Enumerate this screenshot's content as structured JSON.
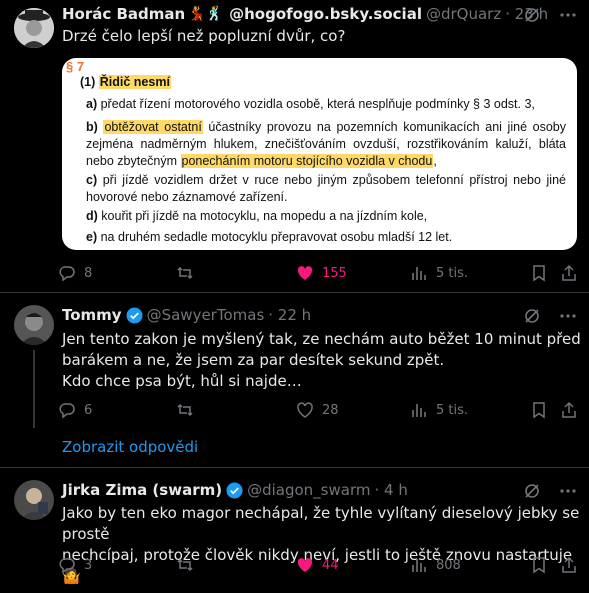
{
  "tweets": [
    {
      "name": "Horác Badman",
      "name_emoji": "💃🕺",
      "bsky": "@hogofogo.bsky.social",
      "handle": "@drQuarz",
      "time": "· 23 h",
      "text": "Drzé čelo lepší než popluzní dvůr, co?",
      "stats": {
        "replies": "8",
        "retweets": "",
        "likes": "155",
        "views": "5 tis."
      }
    },
    {
      "name": "Tommy",
      "handle": "@SawyerTomas",
      "time": "· 22 h",
      "text": "Jen tento zakon je myšlený tak, ze nechám auto běžet 10 minut před\nbarákem a ne, že jsem za par desítek sekund zpět.\nKdo chce psa být, hůl si najde…",
      "stats": {
        "replies": "6",
        "retweets": "",
        "likes": "28",
        "views": "5 tis."
      }
    },
    {
      "name": "Jirka Zima (swarm)",
      "handle": "@diagon_swarm",
      "time": "· 4 h",
      "text": "Jako by ten eko magor nechápal, že tyhle vylítaný dieselový jebky se prostě\nnechcípaj, protože člověk nikdy neví, jestli to ještě znovu nastartuje 🤷",
      "stats": {
        "replies": "3",
        "retweets": "",
        "likes": "44",
        "views": "808"
      }
    }
  ],
  "show_replies": "Zobrazit odpovědi",
  "law": {
    "section": "§ 7",
    "lead_num": "(1)",
    "lead_text": "Řidič nesmí",
    "a_letter": "a)",
    "a_text": "předat řízení motorového vozidla osobě, která nesplňuje podmínky § 3 odst. 3,",
    "b_letter": "b)",
    "b_hl1": "obtěžovat ostatní",
    "b_text1": " účastníky provozu na pozemních komunikacích ani jiné osoby zejména nadměrným hlukem, znečišťováním ovzduší, rozstřikováním kaluží, bláta nebo zbytečným ",
    "b_hl2": "ponecháním motoru stojícího vozidla v chodu",
    "b_text2": ",",
    "c_letter": "c)",
    "c_text": "při jízdě vozidlem držet v ruce nebo jiným způsobem telefonní přístroj nebo jiné hovorové nebo záznamové zařízení.",
    "d_letter": "d)",
    "d_text": "kouřit při jízdě na motocyklu, na mopedu a na jízdním kole,",
    "e_letter": "e)",
    "e_text": "na druhém sedadle motocyklu přepravovat osobu mladší 12 let."
  },
  "colors": {
    "like": "#f91880",
    "link": "#1d9bf0",
    "verified": "#1d9bf0",
    "highlight": "#ffd966",
    "section": "#e8782b"
  },
  "icons": [
    "reply-icon",
    "retweet-icon",
    "heart-icon",
    "views-icon",
    "bookmark-icon",
    "share-icon",
    "grok-icon",
    "more-icon",
    "verified-icon"
  ]
}
